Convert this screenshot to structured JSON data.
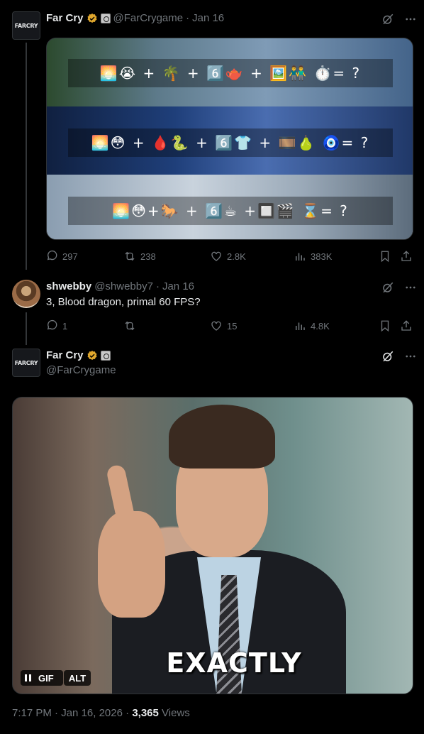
{
  "tweet1": {
    "avatar_text": "FARCRY",
    "name": "Far Cry",
    "handle": "@FarCrygame",
    "sep": "·",
    "date": "Jan 16",
    "rows": [
      "🌅😭 + 🌴 + 6️⃣🫖 + 🖼️👬 ⏱️= ?",
      "🌅😳 + 🩸🐍 + 6️⃣👕 + 🎞️🍐 🧿= ?",
      "🌅😳+🐎 + 6️⃣☕ +🔲🎬 ⌛= ?"
    ],
    "stats": {
      "replies": "297",
      "reposts": "238",
      "likes": "2.8K",
      "views": "383K"
    }
  },
  "tweet2": {
    "name": "shwebby",
    "handle": "@shwebby7",
    "sep": "·",
    "date": "Jan 16",
    "text": "3, Blood dragon, primal 60 FPS?",
    "stats": {
      "replies": "1",
      "reposts": "",
      "likes": "15",
      "views": "4.8K"
    }
  },
  "tweet3": {
    "avatar_text": "FARCRY",
    "name": "Far Cry",
    "handle": "@FarCrygame",
    "gif_caption": "EXACTLY",
    "gif_label": "GIF",
    "alt_label": "ALT",
    "time": "7:17 PM",
    "sep": "·",
    "full_date": "Jan 16, 2026",
    "views_count": "3,365",
    "views_label": "Views"
  },
  "icons": {
    "verified": "verified-badge-icon",
    "grok": "grok-icon",
    "more": "more-icon",
    "reply": "reply-icon",
    "repost": "repost-icon",
    "like": "like-icon",
    "views": "views-icon",
    "bookmark": "bookmark-icon",
    "share": "share-icon"
  },
  "colors": {
    "background": "#000000",
    "muted": "#71767b",
    "text": "#e7e9ea",
    "verified": "#e0a72d"
  }
}
